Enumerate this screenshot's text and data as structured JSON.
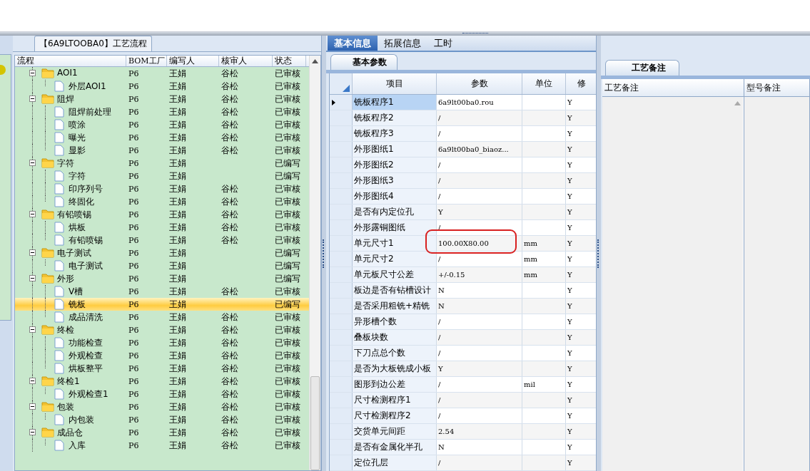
{
  "flow_panel": {
    "title": "【6A9LTOOBA0】工艺流程",
    "columns": [
      "流程",
      "BOM工厂",
      "编写人",
      "核审人",
      "状态"
    ],
    "tree": [
      {
        "name": "AOI1",
        "bom": "P6",
        "writer": "王娟",
        "reviewer": "谷松",
        "status": "已审核",
        "expanded": true,
        "selected": false,
        "children": [
          {
            "name": "外层AOI1",
            "bom": "P6",
            "writer": "王娟",
            "reviewer": "谷松",
            "status": "已审核",
            "selected": false
          }
        ]
      },
      {
        "name": "阻焊",
        "bom": "P6",
        "writer": "王娟",
        "reviewer": "谷松",
        "status": "已审核",
        "expanded": true,
        "selected": false,
        "children": [
          {
            "name": "阻焊前处理",
            "bom": "P6",
            "writer": "王娟",
            "reviewer": "谷松",
            "status": "已审核",
            "selected": false
          },
          {
            "name": "喷涂",
            "bom": "P6",
            "writer": "王娟",
            "reviewer": "谷松",
            "status": "已审核",
            "selected": false
          },
          {
            "name": "曝光",
            "bom": "P6",
            "writer": "王娟",
            "reviewer": "谷松",
            "status": "已审核",
            "selected": false
          },
          {
            "name": "显影",
            "bom": "P6",
            "writer": "王娟",
            "reviewer": "谷松",
            "status": "已审核",
            "selected": false
          }
        ]
      },
      {
        "name": "字符",
        "bom": "P6",
        "writer": "王娟",
        "status": "已编写",
        "expanded": true,
        "selected": false,
        "children": [
          {
            "name": "字符",
            "bom": "P6",
            "writer": "王娟",
            "status": "已编写",
            "selected": false
          },
          {
            "name": "印序列号",
            "bom": "P6",
            "writer": "王娟",
            "reviewer": "谷松",
            "status": "已审核",
            "selected": false
          },
          {
            "name": "终固化",
            "bom": "P6",
            "writer": "王娟",
            "reviewer": "谷松",
            "status": "已审核",
            "selected": false
          }
        ]
      },
      {
        "name": "有铅喷锡",
        "bom": "P6",
        "writer": "王娟",
        "reviewer": "谷松",
        "status": "已审核",
        "expanded": true,
        "selected": false,
        "children": [
          {
            "name": "烘板",
            "bom": "P6",
            "writer": "王娟",
            "reviewer": "谷松",
            "status": "已审核",
            "selected": false
          },
          {
            "name": "有铅喷锡",
            "bom": "P6",
            "writer": "王娟",
            "reviewer": "谷松",
            "status": "已审核",
            "selected": false
          }
        ]
      },
      {
        "name": "电子测试",
        "bom": "P6",
        "writer": "王娟",
        "status": "已编写",
        "expanded": true,
        "selected": false,
        "children": [
          {
            "name": "电子测试",
            "bom": "P6",
            "writer": "王娟",
            "status": "已编写",
            "selected": false
          }
        ]
      },
      {
        "name": "外形",
        "bom": "P6",
        "writer": "王娟",
        "status": "已编写",
        "expanded": true,
        "selected": false,
        "children": [
          {
            "name": "V槽",
            "bom": "P6",
            "writer": "王娟",
            "reviewer": "谷松",
            "status": "已审核",
            "selected": false
          },
          {
            "name": "铣板",
            "bom": "P6",
            "writer": "王娟",
            "status": "已编写",
            "selected": true
          },
          {
            "name": "成品清洗",
            "bom": "P6",
            "writer": "王娟",
            "reviewer": "谷松",
            "status": "已审核",
            "selected": false
          }
        ]
      },
      {
        "name": "终检",
        "bom": "P6",
        "writer": "王娟",
        "reviewer": "谷松",
        "status": "已审核",
        "expanded": true,
        "selected": false,
        "children": [
          {
            "name": "功能检查",
            "bom": "P6",
            "writer": "王娟",
            "reviewer": "谷松",
            "status": "已审核",
            "selected": false
          },
          {
            "name": "外观检查",
            "bom": "P6",
            "writer": "王娟",
            "reviewer": "谷松",
            "status": "已审核",
            "selected": false
          },
          {
            "name": "烘板整平",
            "bom": "P6",
            "writer": "王娟",
            "reviewer": "谷松",
            "status": "已审核",
            "selected": false
          }
        ]
      },
      {
        "name": "终检1",
        "bom": "P6",
        "writer": "王娟",
        "reviewer": "谷松",
        "status": "已审核",
        "expanded": true,
        "selected": false,
        "children": [
          {
            "name": "外观检查1",
            "bom": "P6",
            "writer": "王娟",
            "reviewer": "谷松",
            "status": "已审核",
            "selected": false
          }
        ]
      },
      {
        "name": "包装",
        "bom": "P6",
        "writer": "王娟",
        "reviewer": "谷松",
        "status": "已审核",
        "expanded": true,
        "selected": false,
        "children": [
          {
            "name": "内包装",
            "bom": "P6",
            "writer": "王娟",
            "reviewer": "谷松",
            "status": "已审核",
            "selected": false
          }
        ]
      },
      {
        "name": "成品仓",
        "bom": "P6",
        "writer": "王娟",
        "reviewer": "谷松",
        "status": "已审核",
        "expanded": true,
        "selected": false,
        "children": [
          {
            "name": "入库",
            "bom": "P6",
            "writer": "王娟",
            "reviewer": "谷松",
            "status": "已审核",
            "selected": false
          }
        ]
      }
    ]
  },
  "detail_tabs": [
    {
      "label": "基本信息",
      "selected": true
    },
    {
      "label": "拓展信息",
      "selected": false
    },
    {
      "label": "工时",
      "selected": false
    }
  ],
  "sub_tab": "基本参数",
  "params": {
    "columns": [
      "项目",
      "参数",
      "单位",
      "修"
    ],
    "rows": [
      {
        "item": "铣板程序1",
        "param": "6a9lt00ba0.rou",
        "modify": "Y",
        "selected": true,
        "highlighted": false
      },
      {
        "item": "铣板程序2",
        "param": "/",
        "modify": "Y",
        "selected": false,
        "highlighted": false
      },
      {
        "item": "铣板程序3",
        "param": "/",
        "modify": "Y",
        "selected": false,
        "highlighted": false
      },
      {
        "item": "外形图纸1",
        "param": "6a9lt00ba0_biaoz...",
        "modify": "Y",
        "selected": false,
        "highlighted": false
      },
      {
        "item": "外形图纸2",
        "param": "/",
        "modify": "Y",
        "selected": false,
        "highlighted": false
      },
      {
        "item": "外形图纸3",
        "param": "/",
        "modify": "Y",
        "selected": false,
        "highlighted": false
      },
      {
        "item": "外形图纸4",
        "param": "/",
        "modify": "Y",
        "selected": false,
        "highlighted": false
      },
      {
        "item": "是否有内定位孔",
        "param": "Y",
        "modify": "Y",
        "selected": false,
        "highlighted": false
      },
      {
        "item": "外形露铜图纸",
        "param": "/",
        "modify": "Y",
        "selected": false,
        "highlighted": false
      },
      {
        "item": "单元尺寸1",
        "param": "100.00X80.00",
        "unit": "mm",
        "modify": "Y",
        "selected": false,
        "highlighted": true
      },
      {
        "item": "单元尺寸2",
        "param": "/",
        "unit": "mm",
        "modify": "Y",
        "selected": false,
        "highlighted": false
      },
      {
        "item": "单元板尺寸公差",
        "param": "+/-0.15",
        "unit": "mm",
        "modify": "Y",
        "selected": false,
        "highlighted": false
      },
      {
        "item": "板边是否有钻槽设计",
        "param": "N",
        "modify": "Y",
        "selected": false,
        "highlighted": false
      },
      {
        "item": "是否采用粗铣+精铣",
        "param": "N",
        "modify": "Y",
        "selected": false,
        "highlighted": false
      },
      {
        "item": "异形槽个数",
        "param": "/",
        "modify": "Y",
        "selected": false,
        "highlighted": false
      },
      {
        "item": "叠板块数",
        "param": "/",
        "modify": "Y",
        "selected": false,
        "highlighted": false
      },
      {
        "item": "下刀点总个数",
        "param": "/",
        "modify": "Y",
        "selected": false,
        "highlighted": false
      },
      {
        "item": "是否为大板铣成小板",
        "param": "Y",
        "modify": "Y",
        "selected": false,
        "highlighted": false
      },
      {
        "item": "图形到边公差",
        "param": "/",
        "unit": "mil",
        "modify": "Y",
        "selected": false,
        "highlighted": false
      },
      {
        "item": "尺寸检测程序1",
        "param": "/",
        "modify": "Y",
        "selected": false,
        "highlighted": false
      },
      {
        "item": "尺寸检测程序2",
        "param": "/",
        "modify": "Y",
        "selected": false,
        "highlighted": false
      },
      {
        "item": "交货单元间距",
        "param": "2.54",
        "modify": "Y",
        "selected": false,
        "highlighted": false
      },
      {
        "item": "是否有金属化半孔",
        "param": "N",
        "modify": "Y",
        "selected": false,
        "highlighted": false
      },
      {
        "item": "定位孔层",
        "param": "/",
        "modify": "Y",
        "selected": false,
        "highlighted": false
      }
    ]
  },
  "notes_panel": {
    "tab": "工艺备注",
    "columns": [
      "工艺备注",
      "型号备注"
    ]
  }
}
